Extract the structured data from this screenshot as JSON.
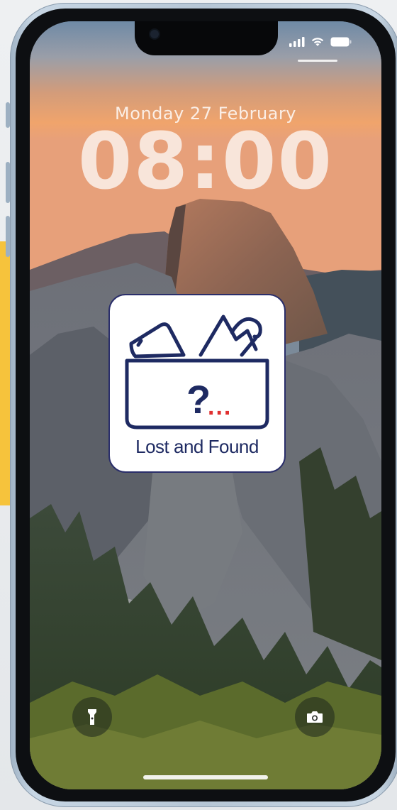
{
  "lockscreen": {
    "date": "Monday 27 February",
    "time": "08:00"
  },
  "widget": {
    "label": "Lost and Found",
    "icon": "lost-and-found-box-icon",
    "question_mark": "?",
    "dots": "..."
  },
  "status_bar": {
    "signal_icon": "cellular-signal-icon",
    "wifi_icon": "wifi-icon",
    "battery_icon": "battery-icon"
  },
  "quick_actions": {
    "left_icon": "flashlight-icon",
    "right_icon": "camera-icon"
  },
  "colors": {
    "accent_yellow": "#f6c33c",
    "widget_navy": "#1e2a62",
    "widget_dots_red": "#e03030",
    "phone_frame": "#b6c6d5"
  }
}
